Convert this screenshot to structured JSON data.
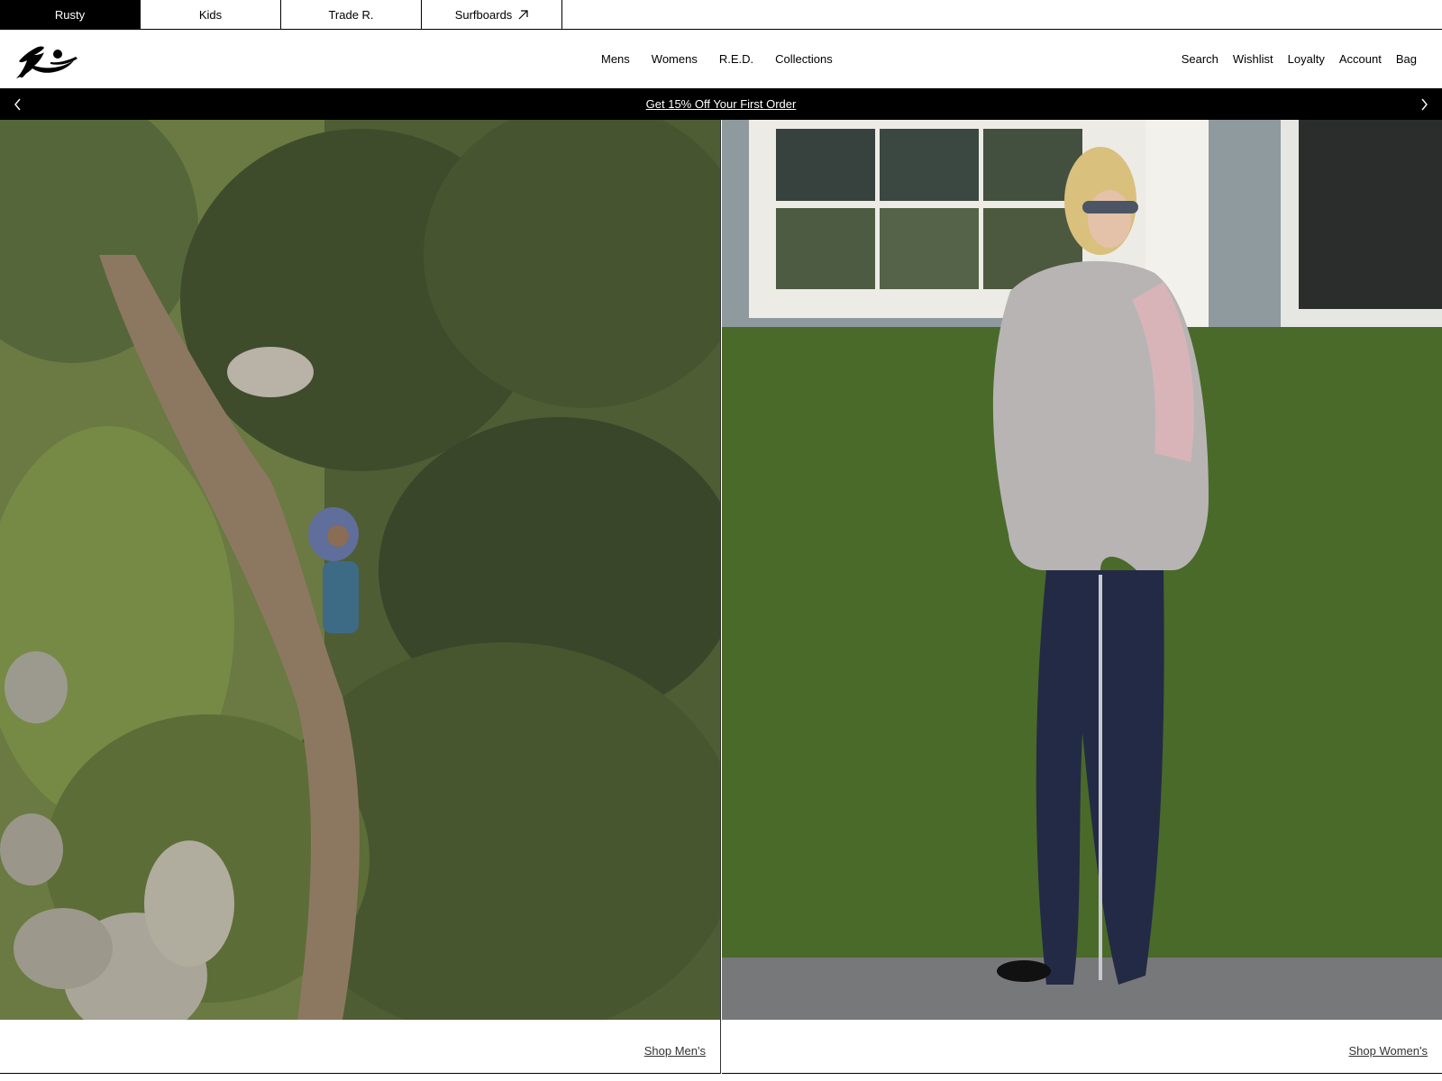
{
  "brand_tabs": [
    {
      "label": "Rusty",
      "active": true
    },
    {
      "label": "Kids",
      "active": false
    },
    {
      "label": "Trade R.",
      "active": false
    },
    {
      "label": "Surfboards",
      "active": false,
      "icon": "external-link-icon"
    }
  ],
  "header": {
    "logo": "rusty-logo",
    "main_nav": [
      "Mens",
      "Womens",
      "R.E.D.",
      "Collections"
    ],
    "util_nav": [
      "Search",
      "Wishlist",
      "Loyalty",
      "Account",
      "Bag"
    ]
  },
  "announcement": {
    "text": "Get 15% Off Your First Order",
    "prev_icon": "chevron-left-icon",
    "next_icon": "chevron-right-icon",
    "color": "#000000"
  },
  "hero": {
    "mens": {
      "image": "aerial-man-lying-in-bushes",
      "cta": "Shop Men's"
    },
    "womens": {
      "image": "woman-fleece-jacket-hedge",
      "cta": "Shop Women's"
    }
  }
}
